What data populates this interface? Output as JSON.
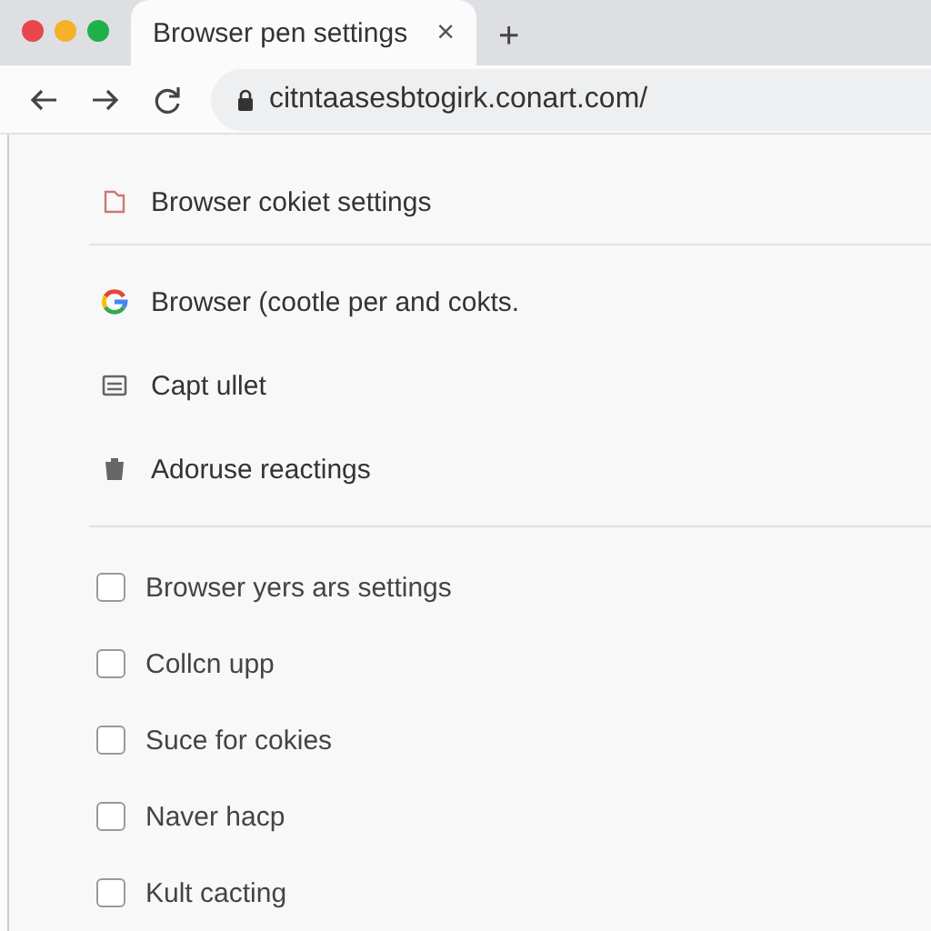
{
  "tab": {
    "title": "Browser pen settings",
    "close": "×"
  },
  "new_tab": "+",
  "address": {
    "url": "citntaasesbtogirk.conart.com/"
  },
  "menu_items": [
    {
      "kind": "folder",
      "label": "Browser cokiet settings"
    },
    {
      "kind": "google",
      "label": "Browser (cootle per and cokts."
    },
    {
      "kind": "list",
      "label": "Capt ullet"
    },
    {
      "kind": "trash",
      "label": "Adoruse reactings"
    }
  ],
  "options": [
    {
      "label": "Browser yers ars settings",
      "checked": false
    },
    {
      "label": "Collcn upp",
      "checked": false
    },
    {
      "label": "Suce for cokies",
      "checked": false
    },
    {
      "label": "Naver hacp",
      "checked": false
    },
    {
      "label": "Kult cacting",
      "checked": false
    }
  ]
}
